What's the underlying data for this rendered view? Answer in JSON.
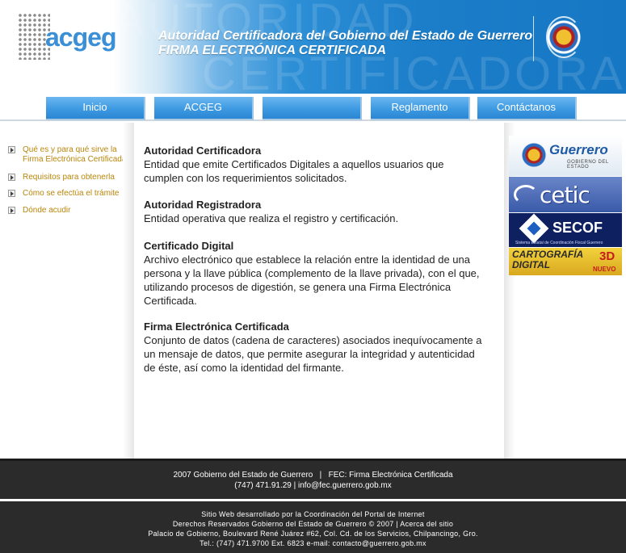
{
  "header": {
    "logo_text": "acgeg",
    "title_line1": "Autoridad Certificadora del Gobierno del Estado de Guerrero",
    "title_line2": "FIRMA ELECTRÓNICA CERTIFICADA",
    "watermark1": "AUTORIDAD",
    "watermark2": "CERTIFICADORA"
  },
  "nav": {
    "items": [
      "Inicio",
      "ACGEG",
      "",
      "Reglamento",
      "Contáctanos"
    ]
  },
  "sidebar": {
    "items": [
      "Qué es y para qué sirve la Firma Electrónica Certificada",
      "Requisitos para obtenerla",
      "Cómo se efectúa el trámite",
      "Dónde acudir"
    ]
  },
  "main": {
    "sections": [
      {
        "title": "Autoridad Certificadora",
        "body": "Entidad que emite Certificados Digitales a aquellos usuarios que cumplen con los requerimientos solicitados."
      },
      {
        "title": "Autoridad Registradora",
        "body": "Entidad operativa que realiza el registro y certificación."
      },
      {
        "title": "Certificado Digital",
        "body": "Archivo electrónico que establece la relación entre la identidad de una persona y la llave pública (complemento de la llave privada), con el que, utilizando procesos de digestión, se genera una Firma Electrónica Certificada."
      },
      {
        "title": "Firma Electrónica Certificada",
        "body": "Conjunto de datos (cadena de caracteres) asociados inequívocamente a un mensaje de datos, que permite asegurar la integridad y autenticidad de éste, así como la identidad del firmante."
      }
    ]
  },
  "banners": {
    "guerrero": {
      "title": "Guerrero",
      "subtitle": "GOBIERNO DEL ESTADO"
    },
    "cetic": {
      "title": "cetic"
    },
    "secof": {
      "title": "SECOF",
      "subtitle": "Sistema Estatal de Coordinación Fiscal Guerrero"
    },
    "cartografia": {
      "line1": "CARTOGRAFÍA",
      "line2": "DIGITAL",
      "badge": "3D",
      "tag": "NUEVO"
    }
  },
  "footer": {
    "line1": "2007 Gobierno del Estado de Guerrero   |   FEC: Firma Electrónica Certificada",
    "line2": "(747) 471.91.29 | info@fec.guerrero.gob.mx",
    "credits": [
      "Sitio Web desarrollado por la Coordinación del Portal de Internet",
      "Derechos Reservados Gobierno del Estado de Guerrero © 2007 | Acerca del sitio",
      "Palacio de Gobierno, Boulevard René Juárez #62, Col. Cd. de los Servicios, Chilpancingo, Gro.",
      "Tel.: (747) 471.9700 Ext. 6823 e-mail: contacto@guerrero.gob.mx"
    ]
  },
  "colors": {
    "header_blue": "#1678c4",
    "nav_blue": "#3d9ae2",
    "sidebar_link": "#b8860b",
    "footer_bg": "#2b2b2b"
  }
}
